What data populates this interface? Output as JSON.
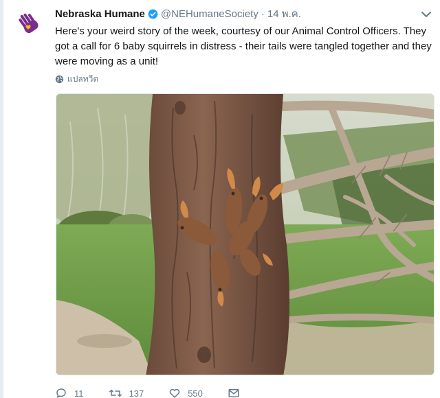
{
  "tweet": {
    "display_name": "Nebraska Humane",
    "handle": "@NEHumaneSociety",
    "separator": "·",
    "time": "14 พ.ค.",
    "text": "Here's your weird story of the week, courtesy of our Animal Control Officers. They got a call for 6 baby squirrels in distress - their tails were tangled together and they were moving as a unit!",
    "translate_label": "แปลทวีต",
    "icons": {
      "avatar": "purple-hand-heart-logo",
      "verified": "verified-badge-icon",
      "menu": "chevron-down-icon",
      "translate": "globe-icon",
      "reply": "reply-icon",
      "retweet": "retweet-icon",
      "like": "heart-icon",
      "dm": "envelope-icon"
    },
    "counts": {
      "replies": "11",
      "retweets": "137",
      "likes": "550"
    }
  },
  "colors": {
    "brand_purple": "#7b2d8e",
    "verified_blue": "#1da1f2",
    "secondary_text": "#657786"
  }
}
